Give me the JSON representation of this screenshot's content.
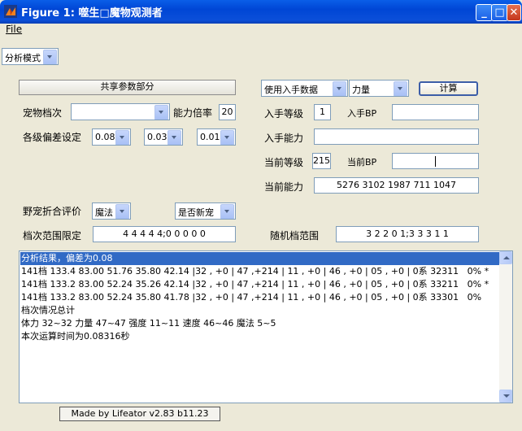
{
  "window": {
    "title": "Figure 1: 噬生□魔物观测者",
    "menu_file": "File",
    "minimize": "_",
    "maximize": "□",
    "close": "✕"
  },
  "mode_select": "分析模式",
  "shared_params_button": "共享参数部分",
  "pet_tier": {
    "label": "宠物档次",
    "value": ""
  },
  "ability_ratio": {
    "label": "能力倍率",
    "value": "20"
  },
  "deviation": {
    "label": "各级偏差设定",
    "values": [
      "0.08",
      "0.03",
      "0.01"
    ]
  },
  "input_data_select": "使用入手数据",
  "stat_select": "力量",
  "calc_button": "计算",
  "obtain_level": {
    "label": "入手等级",
    "value": "1"
  },
  "obtain_bp": {
    "label": "入手BP",
    "value": ""
  },
  "obtain_ability": {
    "label": "入手能力",
    "value": ""
  },
  "current_level": {
    "label": "当前等级",
    "value": "215"
  },
  "current_bp": {
    "label": "当前BP",
    "value": ""
  },
  "current_ability": {
    "label": "当前能力",
    "value": "5276 3102 1987 711 1047"
  },
  "wild_eval": {
    "label": "野宠折合评价",
    "select": "魔法",
    "new_pet_select": "是否新宠"
  },
  "tier_limit": {
    "label": "档次范围限定",
    "value": "4 4 4 4 4;0 0 0 0 0"
  },
  "random_range": {
    "label": "随机档范围",
    "value": "3 2 2 0 1;3 3 3 1 1"
  },
  "results": [
    "分析结果，偏差为0.08",
    "141档 133.4 83.00 51.76 35.80 42.14 |32 , +0 | 47 ,+214 | 11 , +0 | 46 , +0 | 05 , +0 | 0系 32311   0% *",
    "141档 133.2 83.00 52.24 35.26 42.14 |32 , +0 | 47 ,+214 | 11 , +0 | 46 , +0 | 05 , +0 | 0系 33211   0% *",
    "141档 133.2 83.00 52.24 35.80 41.78 |32 , +0 | 47 ,+214 | 11 , +0 | 46 , +0 | 05 , +0 | 0系 33301   0%",
    "档次情况总计",
    "体力 32~32 力量 47~47 强度 11~11 速度 46~46 魔法 5~5",
    "本次运算时间为0.08316秒"
  ],
  "footer": "Made by Lifeator   v2.83 b11.23",
  "colors": {
    "title_bar": "#0a5ee8",
    "selection": "#316ac5",
    "background": "#ece9d8"
  }
}
